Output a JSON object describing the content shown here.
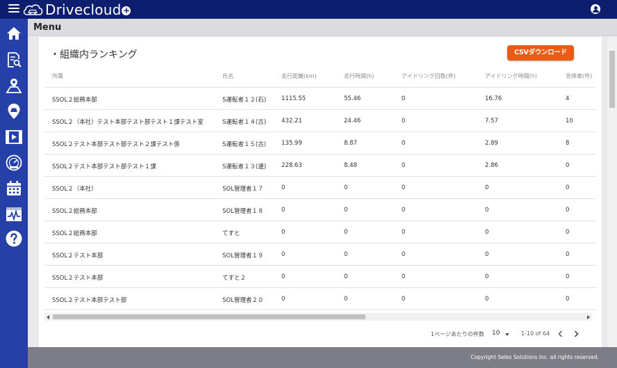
{
  "app": {
    "brand": "Drivecloud",
    "brand_plus": "+"
  },
  "sidebar": {
    "items": [
      {
        "icon": "home-icon"
      },
      {
        "icon": "report-search-icon"
      },
      {
        "icon": "map-route-icon"
      },
      {
        "icon": "car-location-icon"
      },
      {
        "icon": "video-icon"
      },
      {
        "icon": "speedometer-icon"
      },
      {
        "icon": "calendar-icon"
      },
      {
        "icon": "activity-chart-icon"
      },
      {
        "icon": "help-icon"
      }
    ]
  },
  "header": {
    "menu_title": "Menu"
  },
  "main": {
    "section_title": "・組織内ランキング",
    "csv_button": "CSVダウンロード",
    "columns": [
      "所属",
      "氏名",
      "走行距離(km)",
      "走行時間(h)",
      "アイドリング回数(件)",
      "アイドリング時間(h)",
      "急停車(件)"
    ],
    "rows": [
      [
        "SSOL２総務本部",
        "S運転者１２(石)",
        "1115.55",
        "55.46",
        "0",
        "16.76",
        "4"
      ],
      [
        "SSOL２（本社）テスト本部テスト部テスト１課テスト室",
        "S運転者１４(古)",
        "432.21",
        "24.46",
        "0",
        "7.57",
        "10"
      ],
      [
        "SSOL２テスト本部テスト部テスト２課テスト係",
        "S運転者１５(古)",
        "135.99",
        "8.87",
        "0",
        "2.89",
        "8"
      ],
      [
        "SSOL２テスト本部テスト部テスト１課",
        "S運転者１３(邊)",
        "228.63",
        "8.48",
        "0",
        "2.86",
        "0"
      ],
      [
        "SSOL２（本社）",
        "SOL管理者１７",
        "0",
        "0",
        "0",
        "0",
        "0"
      ],
      [
        "SSOL２総務本部",
        "SOL管理者１８",
        "0",
        "0",
        "0",
        "0",
        "0"
      ],
      [
        "SSOL２総務本部",
        "てすと",
        "0",
        "0",
        "0",
        "0",
        "0"
      ],
      [
        "SSOL２テスト本部",
        "SOL管理者１９",
        "0",
        "0",
        "0",
        "0",
        "0"
      ],
      [
        "SSOL２テスト本部",
        "てすと２",
        "0",
        "0",
        "0",
        "0",
        "0"
      ],
      [
        "SSOL２テスト本部テスト部",
        "SOL管理者２０",
        "0",
        "0",
        "0",
        "0",
        "0"
      ]
    ],
    "pager": {
      "rows_per_page_label": "1ページあたりの件数",
      "rows_per_page_value": "10",
      "range": "1-10 of 64"
    }
  },
  "footer": {
    "copyright": "Copyright Seiko Solutions Inc. all rights reserved."
  },
  "colors": {
    "topbar": "#0e1e6e",
    "sidebar": "#2541a8",
    "accent": "#ea5b16"
  }
}
